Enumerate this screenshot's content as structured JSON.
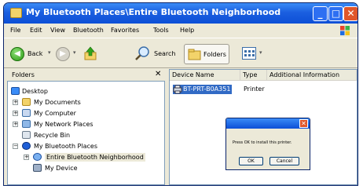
{
  "window": {
    "title": "My Bluetooth Places\\Entire Bluetooth Neighborhood"
  },
  "title_buttons": {
    "minimize": "_",
    "maximize": "□",
    "close": "✕"
  },
  "menu": {
    "items": [
      "File",
      "Edit",
      "View",
      "Bluetooth",
      "Favorites",
      "Tools",
      "Help"
    ]
  },
  "toolbar": {
    "back_label": "Back",
    "search_label": "Search",
    "folders_label": "Folders"
  },
  "folders_pane": {
    "header": "Folders",
    "close_glyph": "✕",
    "tree": [
      {
        "label": "Desktop",
        "icon": "desktop-icon"
      },
      {
        "label": "My Documents",
        "icon": "folder-icon",
        "expander": "+"
      },
      {
        "label": "My Computer",
        "icon": "computer-icon",
        "expander": "+"
      },
      {
        "label": "My Network Places",
        "icon": "network-icon",
        "expander": "+"
      },
      {
        "label": "Recycle Bin",
        "icon": "recycle-bin-icon"
      },
      {
        "label": "My Bluetooth Places",
        "icon": "bluetooth-icon",
        "expander": "−"
      },
      {
        "label": "Entire Bluetooth Neighborhood",
        "icon": "neighborhood-icon",
        "expander": "+",
        "selected": true
      },
      {
        "label": "My Device",
        "icon": "device-icon"
      }
    ]
  },
  "list": {
    "columns": [
      "Device Name",
      "Type",
      "Additional Information"
    ],
    "rows": [
      {
        "name": "BT-PRT-B0A351",
        "type": "Printer",
        "info": ""
      }
    ]
  },
  "dialog": {
    "message": "Press OK to install this printer.",
    "ok_label": "OK",
    "cancel_label": "Cancel",
    "close_glyph": "✕"
  },
  "colors": {
    "titlebar": "#0c4fd6",
    "selection": "#316ac5",
    "close": "#e0562b"
  }
}
